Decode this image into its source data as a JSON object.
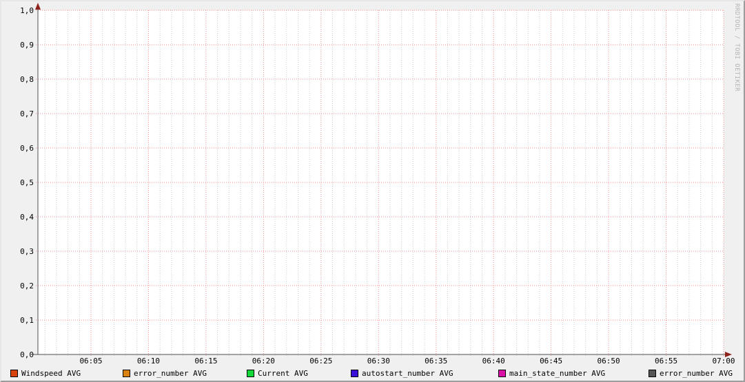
{
  "watermark": "RRDTOOL / TOBI OETIKER",
  "colors": {
    "background": "#f0f0f0",
    "canvas": "#ffffff",
    "axis": "#4f4f4f",
    "arrow": "#8f231d",
    "text": "#000000",
    "minor_grid": "#cccccc",
    "major_grid": "#ef8f8f",
    "watermark": "#b4b4b4"
  },
  "chart_data": {
    "type": "line",
    "title": "",
    "xlabel": "",
    "ylabel": "",
    "x_axis": {
      "tick_labels": [
        "06:05",
        "06:10",
        "06:15",
        "06:20",
        "06:25",
        "06:30",
        "06:35",
        "06:40",
        "06:45",
        "06:50",
        "06:55",
        "07:00"
      ],
      "minor_ticks_per_label": 5,
      "leading_minor_ticks": 4
    },
    "y_axis": {
      "tick_labels": [
        "1,0",
        "0,9",
        "0,8",
        "0,7",
        "0,6",
        "0,5",
        "0,4",
        "0,3",
        "0,2",
        "0,1",
        "0,0"
      ],
      "range": [
        0.0,
        1.0
      ],
      "tick_step": 0.1
    },
    "grid": {
      "shown": true,
      "major_style": "dotted-red",
      "minor_style": "dotted-gray"
    },
    "series": [
      {
        "name": "Windspeed AVG",
        "color": "#d7420f",
        "values": []
      },
      {
        "name": "error_number AVG",
        "color": "#d9820f",
        "values": []
      },
      {
        "name": "Current AVG",
        "color": "#13d938",
        "values": []
      },
      {
        "name": "autostart_number AVG",
        "color": "#3a10d9",
        "values": []
      },
      {
        "name": "main_state_number AVG",
        "color": "#d911a6",
        "values": []
      },
      {
        "name": "error_number AVG",
        "color": "#565656",
        "values": []
      }
    ],
    "legend_position": "bottom"
  }
}
